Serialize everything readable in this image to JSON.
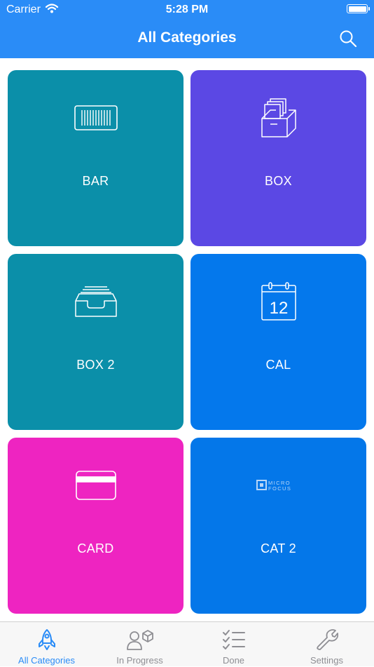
{
  "status_bar": {
    "carrier": "Carrier",
    "time": "5:28 PM"
  },
  "nav": {
    "title": "All Categories"
  },
  "tiles": [
    {
      "label": "BAR",
      "icon": "barcode-icon",
      "color": "#0b8fa9"
    },
    {
      "label": "BOX",
      "icon": "archive-box-icon",
      "color": "#5b48e4"
    },
    {
      "label": "BOX 2",
      "icon": "inbox-tray-icon",
      "color": "#0b8fa9"
    },
    {
      "label": "CAL",
      "icon": "calendar-icon",
      "color": "#0478ec",
      "icon_text": "12"
    },
    {
      "label": "CARD",
      "icon": "credit-card-icon",
      "color": "#ee24c1"
    },
    {
      "label": "CAT 2",
      "icon": "micro-focus-logo",
      "color": "#0477e9",
      "icon_text": [
        "MICRO",
        "FOCUS"
      ]
    }
  ],
  "tabs": [
    {
      "label": "All Categories",
      "icon": "rocket-icon",
      "active": true
    },
    {
      "label": "In Progress",
      "icon": "user-box-icon",
      "active": false
    },
    {
      "label": "Done",
      "icon": "checklist-icon",
      "active": false
    },
    {
      "label": "Settings",
      "icon": "wrench-icon",
      "active": false
    }
  ],
  "colors": {
    "accent": "#2a8cf7",
    "inactive_tab": "#8e8e93"
  }
}
